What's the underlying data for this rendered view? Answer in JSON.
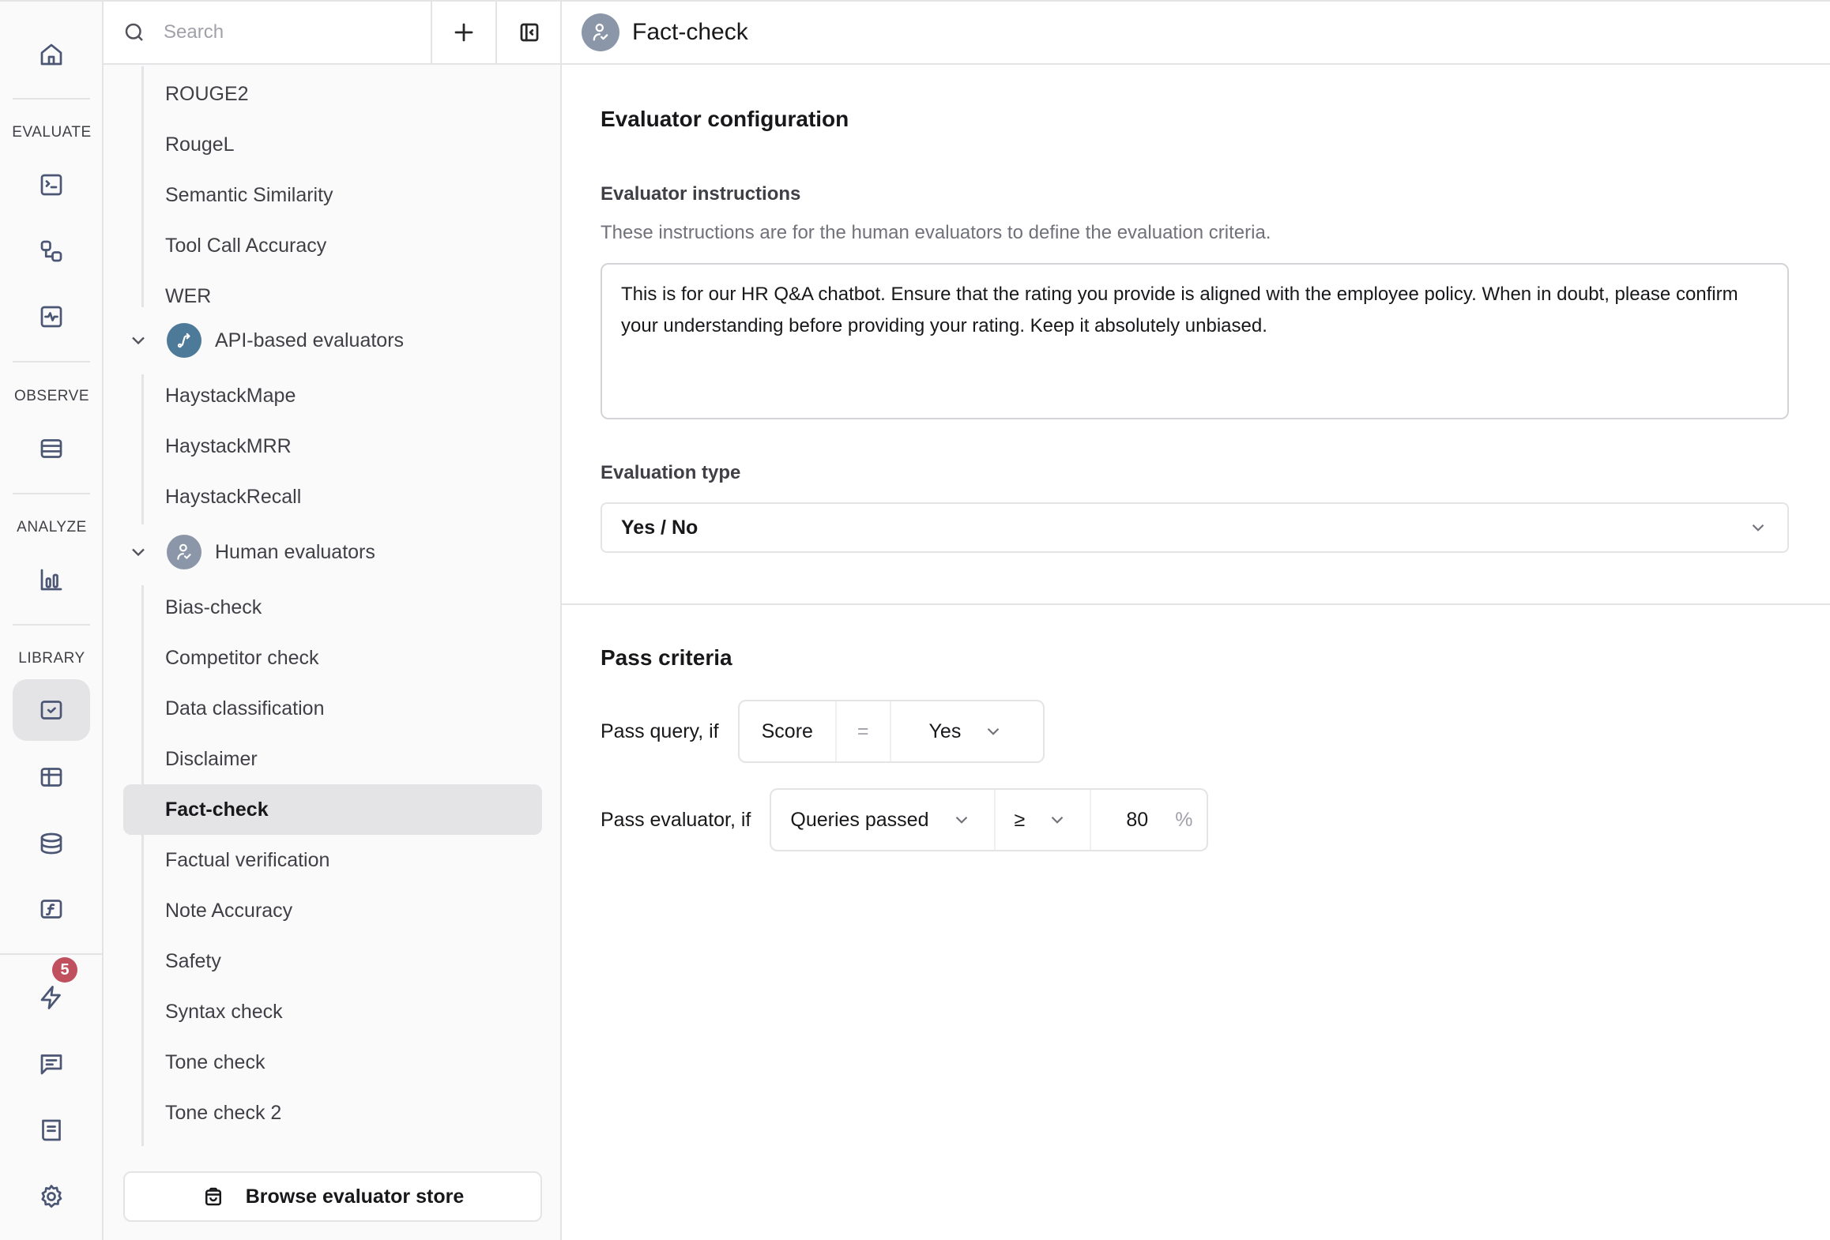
{
  "rail": {
    "home_icon": "home-icon",
    "sections": [
      {
        "label": "EVALUATE",
        "items": [
          "terminal-icon",
          "workflow-icon",
          "activity-icon"
        ]
      },
      {
        "label": "OBSERVE",
        "items": [
          "logs-icon"
        ]
      },
      {
        "label": "ANALYZE",
        "items": [
          "bar-chart-icon"
        ]
      },
      {
        "label": "LIBRARY",
        "items": [
          "evaluators-icon",
          "table-icon",
          "database-icon",
          "function-icon"
        ]
      }
    ],
    "bottom_items": [
      "lightning-icon",
      "chat-icon",
      "docs-icon",
      "settings-icon"
    ],
    "notification_count": "5",
    "active_item": "evaluators-icon"
  },
  "sidebar": {
    "search_placeholder": "Search",
    "search_value": "",
    "add_icon": "plus-icon",
    "collapse_icon": "collapse-sidebar-icon",
    "top_items": [
      "ROUGE2",
      "RougeL",
      "Semantic Similarity",
      "Tool Call Accuracy",
      "WER"
    ],
    "groups": [
      {
        "label": "API-based evaluators",
        "icon": "api-route-icon",
        "color": "#4e7a9a",
        "expanded": true,
        "items": [
          "HaystackMape",
          "HaystackMRR",
          "HaystackRecall"
        ]
      },
      {
        "label": "Human evaluators",
        "icon": "human-check-icon",
        "color": "#8b97a8",
        "expanded": true,
        "items": [
          "Bias-check",
          "Competitor check",
          "Data classification",
          "Disclaimer",
          "Fact-check",
          "Factual verification",
          "Note Accuracy",
          "Safety",
          "Syntax check",
          "Tone check",
          "Tone check 2"
        ]
      }
    ],
    "selected_item": "Fact-check",
    "store_button": "Browse evaluator store"
  },
  "main": {
    "title": "Fact-check",
    "config": {
      "heading": "Evaluator configuration",
      "instructions_label": "Evaluator instructions",
      "instructions_help": "These instructions are for the human evaluators to define the evaluation criteria.",
      "instructions_value": "This is for our HR Q&A chatbot. Ensure that the rating you provide is aligned with the employee policy. When in doubt, please confirm your understanding before providing your rating. Keep it absolutely unbiased.",
      "evaluation_type_label": "Evaluation type",
      "evaluation_type_value": "Yes / No"
    },
    "pass_criteria": {
      "heading": "Pass criteria",
      "query": {
        "label": "Pass query, if",
        "field": "Score",
        "operator": "=",
        "value": "Yes"
      },
      "evaluator": {
        "label": "Pass evaluator, if",
        "metric": "Queries passed",
        "operator": "≥",
        "value": "80",
        "unit": "%"
      }
    }
  }
}
